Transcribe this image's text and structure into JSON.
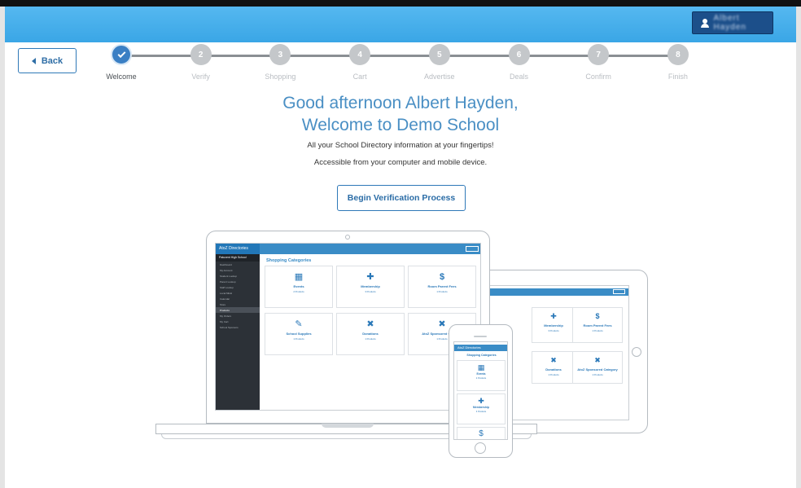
{
  "header": {
    "user_name": "Albert Hayden"
  },
  "back_button": {
    "label": "Back"
  },
  "steps": [
    {
      "number": "1",
      "label": "Welcome",
      "state": "complete"
    },
    {
      "number": "2",
      "label": "Verify",
      "state": "pending"
    },
    {
      "number": "3",
      "label": "Shopping",
      "state": "pending"
    },
    {
      "number": "4",
      "label": "Cart",
      "state": "pending"
    },
    {
      "number": "5",
      "label": "Advertise",
      "state": "pending"
    },
    {
      "number": "6",
      "label": "Deals",
      "state": "pending"
    },
    {
      "number": "7",
      "label": "Confirm",
      "state": "pending"
    },
    {
      "number": "8",
      "label": "Finish",
      "state": "pending"
    }
  ],
  "greeting": {
    "line1": "Good afternoon Albert Hayden,",
    "line2": "Welcome to Demo School",
    "sub1": "All your School Directory information at your fingertips!",
    "sub2": "Accessible from your computer and mobile device."
  },
  "cta": {
    "label": "Begin Verification Process"
  },
  "preview": {
    "brand": "AtoZ Directories",
    "school": "Patuxent High School",
    "title": "Shopping Categories",
    "sidebar_items": [
      "Dashboard",
      "My Account",
      "Student Lookup",
      "Parent Lookup",
      "Staff Lookup",
      "Local Mktsl",
      "Calendar",
      "Store",
      "Products",
      "My Orders",
      "My Cart",
      "School Sponsors"
    ],
    "cards": [
      {
        "icon": "calendar-icon",
        "glyph": "▦",
        "title": "Events",
        "products": "2 Products"
      },
      {
        "icon": "group-icon",
        "glyph": "✚",
        "title": "Membership",
        "products": "3 Products"
      },
      {
        "icon": "dollar-icon",
        "glyph": "$",
        "title": "Room Parent Fees",
        "products": "1 Products"
      },
      {
        "icon": "pencil-icon",
        "glyph": "✎",
        "title": "School Supplies",
        "products": "1 Products"
      },
      {
        "icon": "puzzle-icon",
        "glyph": "✖",
        "title": "Donations",
        "products": "1 Products"
      },
      {
        "icon": "puzzle-icon",
        "glyph": "✖",
        "title": "AtoZ Sponsored Category",
        "products": "1 Products"
      }
    ]
  },
  "colors": {
    "header": "#3aa6e6",
    "accent": "#3a7fc4",
    "user_button": "#1c4f8a",
    "text_accent": "#4a8fc4"
  }
}
